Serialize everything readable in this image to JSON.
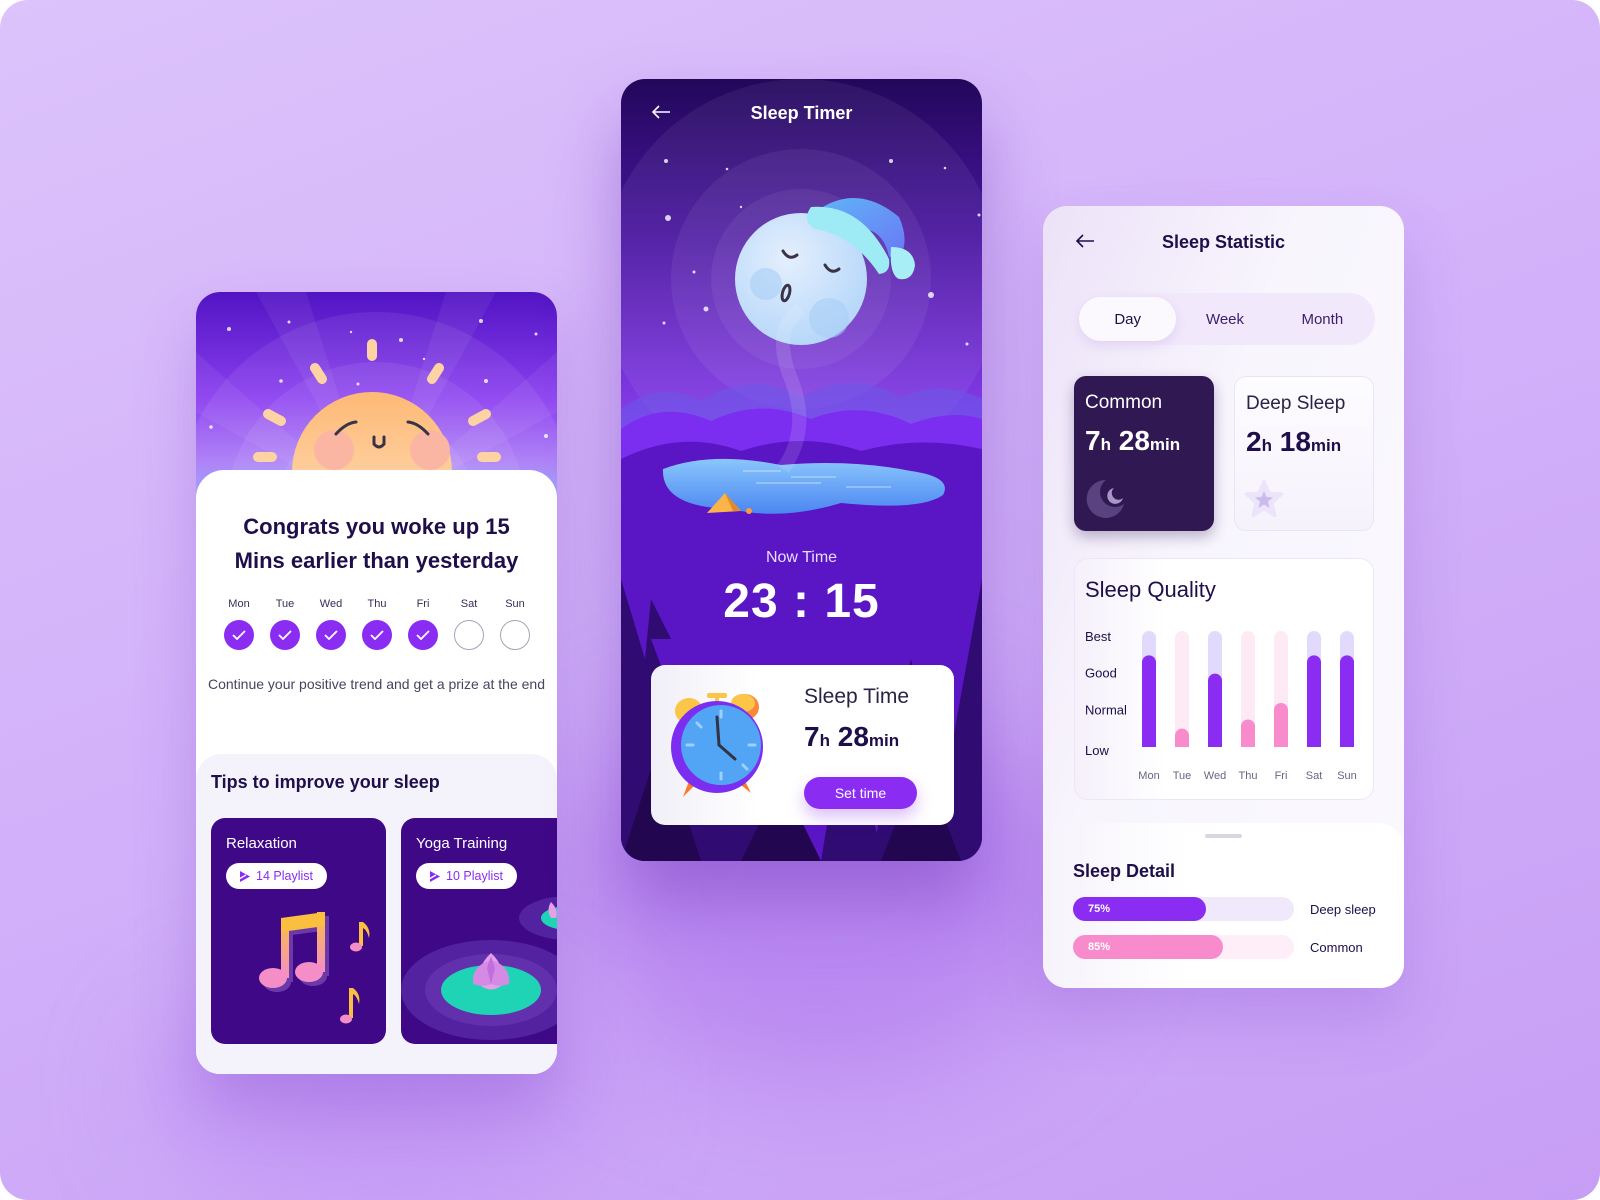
{
  "colors": {
    "primary_purple": "#8a2cf2",
    "pink": "#f78bcb",
    "dark_navy": "#1e0e4a",
    "dark_card": "#301853",
    "tip_card": "#3e0887"
  },
  "congrats_screen": {
    "title": "Congrats you woke up 15 Mins earlier than yesterday",
    "week": [
      {
        "day": "Mon",
        "done": true
      },
      {
        "day": "Tue",
        "done": true
      },
      {
        "day": "Wed",
        "done": true
      },
      {
        "day": "Thu",
        "done": true
      },
      {
        "day": "Fri",
        "done": true
      },
      {
        "day": "Sat",
        "done": false
      },
      {
        "day": "Sun",
        "done": false
      }
    ],
    "subtitle": "Continue your positive trend and get a prize at the end",
    "tips": {
      "title": "Tips to improve your sleep",
      "items": [
        {
          "name": "Relaxation",
          "playlist": "14 Playlist",
          "illustration": "music-notes-icon"
        },
        {
          "name": "Yoga Training",
          "playlist": "10 Playlist",
          "illustration": "lotus-icon"
        }
      ]
    }
  },
  "timer_screen": {
    "title": "Sleep Timer",
    "back_icon": "arrow-left-icon",
    "now_label": "Now Time",
    "now_time": "23 : 15",
    "sleep_time": {
      "label": "Sleep Time",
      "hours": "7",
      "hours_unit": "h",
      "minutes": "28",
      "minutes_unit": "min",
      "button": "Set time"
    }
  },
  "stats_screen": {
    "title": "Sleep Statistic",
    "back_icon": "arrow-left-icon",
    "tabs": [
      {
        "label": "Day",
        "active": true
      },
      {
        "label": "Week",
        "active": false
      },
      {
        "label": "Month",
        "active": false
      }
    ],
    "common": {
      "label": "Common",
      "hours": "7",
      "minutes": "28",
      "h_unit": "h",
      "min_unit": "min",
      "icon": "moon-icon"
    },
    "deep": {
      "label": "Deep Sleep",
      "hours": "2",
      "minutes": "18",
      "h_unit": "h",
      "min_unit": "min",
      "icon": "star-icon"
    },
    "detail": {
      "title": "Sleep Detail",
      "bars": [
        {
          "name": "Deep sleep",
          "percent": 75,
          "label": "75%",
          "color": "#8a2cf2",
          "track": "#efe9fb"
        },
        {
          "name": "Common",
          "percent": 85,
          "label": "85%",
          "color": "#f78bcb",
          "track": "#fdeef7"
        }
      ]
    }
  },
  "chart_data": {
    "type": "bar",
    "title": "Sleep Quality",
    "categories": [
      "Mon",
      "Tue",
      "Wed",
      "Thu",
      "Fri",
      "Sat",
      "Sun"
    ],
    "y_levels": [
      "Low",
      "Normal",
      "Good",
      "Best"
    ],
    "ylim": [
      0,
      3
    ],
    "values": [
      2.5,
      0.5,
      2.0,
      0.75,
      1.2,
      2.5,
      2.5
    ],
    "bar_colors": [
      "#8a2cf2",
      "#f78bcb",
      "#8a2cf2",
      "#f78bcb",
      "#f78bcb",
      "#8a2cf2",
      "#8a2cf2"
    ],
    "track_colors": [
      "#e2dafc",
      "#fdeaf4",
      "#e2dafc",
      "#fdeaf4",
      "#fdeaf4",
      "#e2dafc",
      "#e2dafc"
    ],
    "grid": false,
    "legend": "none"
  }
}
